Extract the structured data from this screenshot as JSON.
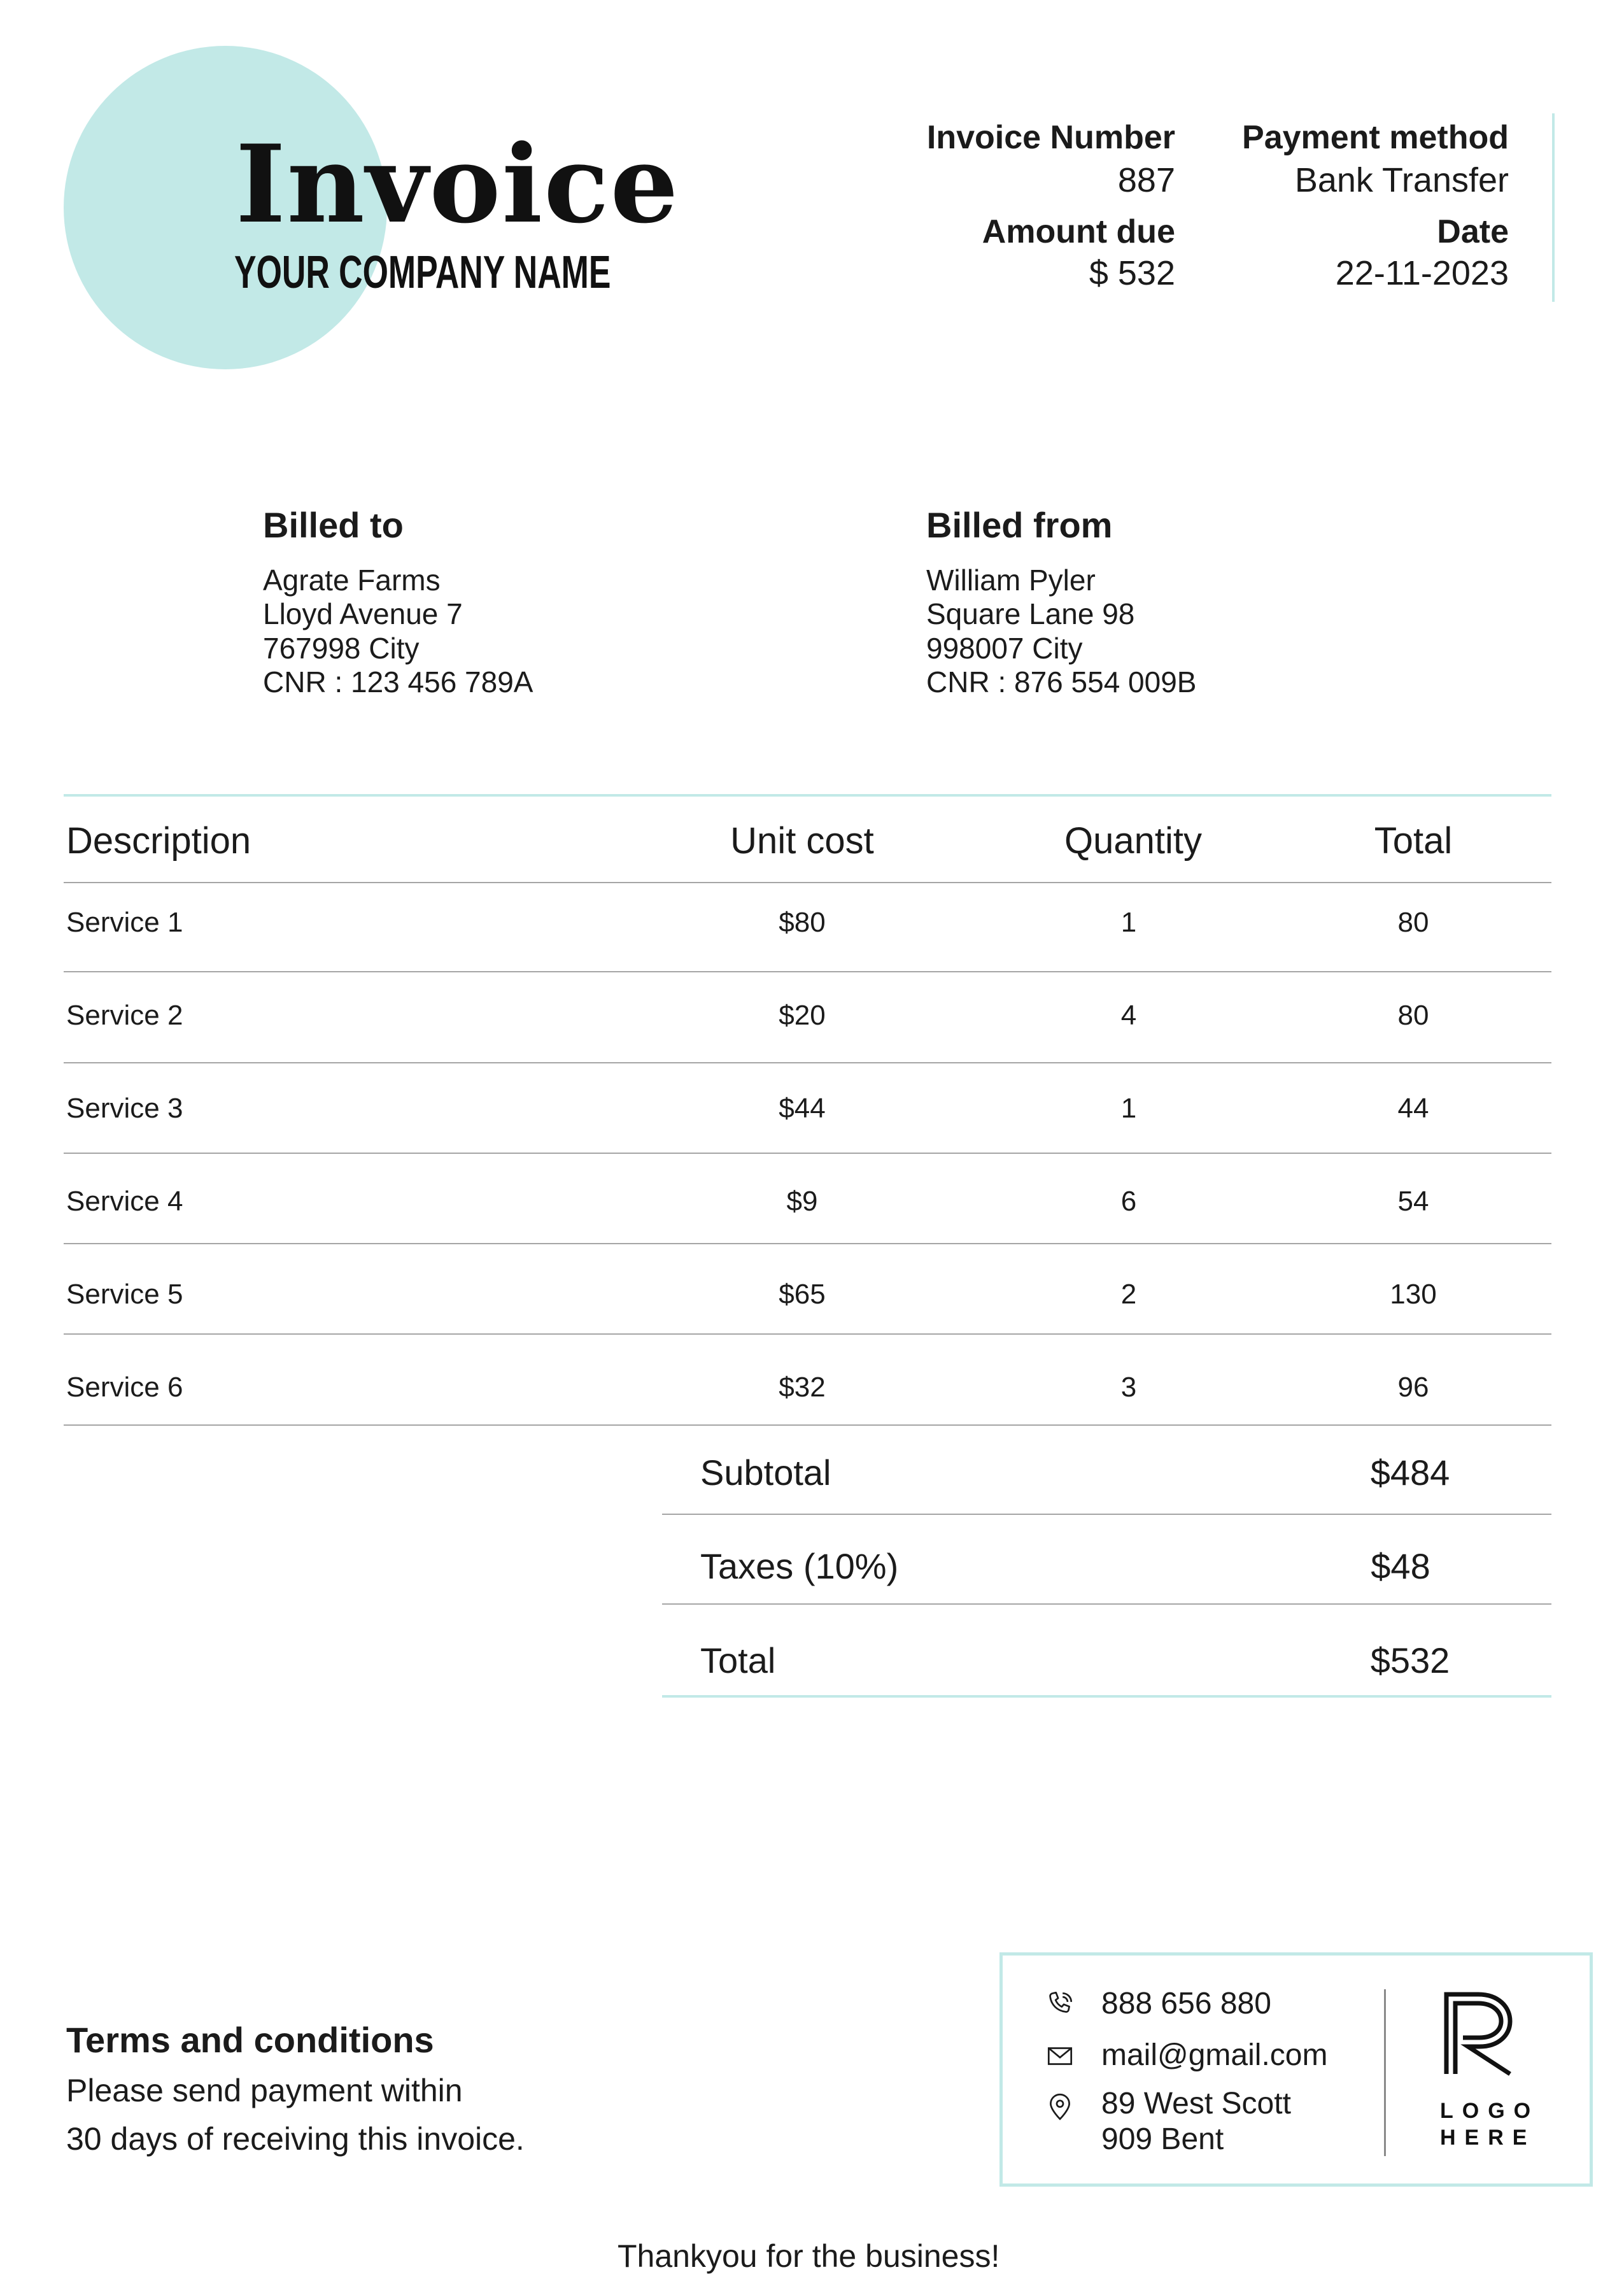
{
  "header": {
    "title": "Invoice",
    "company": "YOUR COMPANY NAME",
    "invoice_number_label": "Invoice Number",
    "invoice_number": "887",
    "payment_method_label": "Payment method",
    "payment_method": "Bank Transfer",
    "amount_due_label": "Amount due",
    "amount_due": "$ 532",
    "date_label": "Date",
    "date": "22-11-2023"
  },
  "billed_to": {
    "heading": "Billed to",
    "lines": [
      "Agrate Farms",
      "Lloyd Avenue 7",
      "767998 City",
      "CNR : 123 456 789A"
    ]
  },
  "billed_from": {
    "heading": "Billed from",
    "lines": [
      "William Pyler",
      "Square Lane 98",
      "998007 City",
      "CNR : 876 554 009B"
    ]
  },
  "table": {
    "headers": [
      "Description",
      "Unit cost",
      "Quantity",
      "Total"
    ],
    "rows": [
      {
        "description": "Service 1",
        "unit_cost": "$80",
        "quantity": "1",
        "total": "80"
      },
      {
        "description": "Service 2",
        "unit_cost": "$20",
        "quantity": "4",
        "total": "80"
      },
      {
        "description": "Service 3",
        "unit_cost": "$44",
        "quantity": "1",
        "total": "44"
      },
      {
        "description": "Service 4",
        "unit_cost": "$9",
        "quantity": "6",
        "total": "54"
      },
      {
        "description": "Service 5",
        "unit_cost": "$65",
        "quantity": "2",
        "total": "130"
      },
      {
        "description": "Service 6",
        "unit_cost": "$32",
        "quantity": "3",
        "total": "96"
      }
    ]
  },
  "summary": {
    "subtotal_label": "Subtotal",
    "subtotal": "$484",
    "taxes_label": "Taxes (10%)",
    "taxes": "$48",
    "total_label": "Total",
    "total": "$532"
  },
  "terms": {
    "heading": "Terms and conditions",
    "line1": "Please send payment within",
    "line2": "30 days of receiving this invoice."
  },
  "contact": {
    "phone": "888 656 880",
    "email": "mail@gmail.com",
    "address_line1": "89 West Scott",
    "address_line2": "909 Bent",
    "icons": [
      "phone-icon",
      "mail-icon",
      "location-pin-icon"
    ]
  },
  "logo": {
    "line1": "LOGO",
    "line2": "HERE"
  },
  "footer": {
    "thanks": "Thankyou for the business!"
  },
  "colors": {
    "accent": "#c2e9e7",
    "text": "#1b1b1b",
    "rule": "#a5a5a5"
  }
}
